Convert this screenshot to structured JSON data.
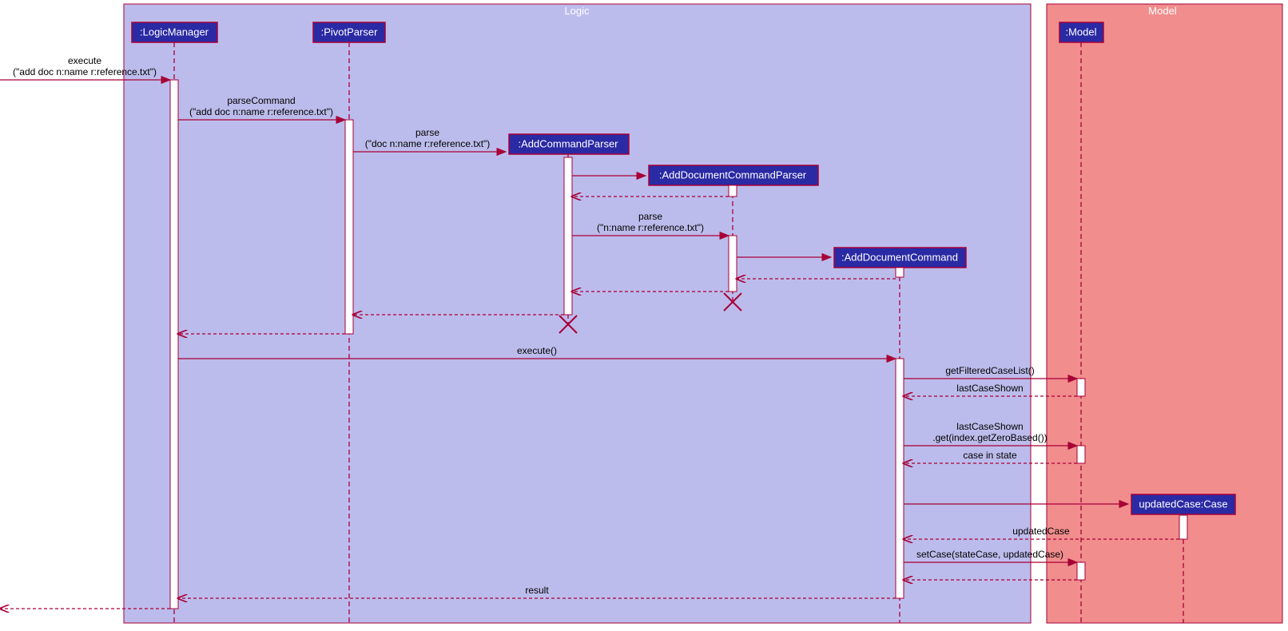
{
  "chart_data": {
    "type": "sequence_diagram",
    "boundaries": [
      {
        "name": "Logic",
        "participants": [
          "LogicManager",
          "PivotParser",
          "AddCommandParser",
          "AddDocumentCommandParser",
          "AddDocumentCommand"
        ]
      },
      {
        "name": "Model",
        "participants": [
          "Model",
          "updatedCase:Case"
        ]
      }
    ],
    "participants": [
      {
        "id": "logicManager",
        "label": ":LogicManager"
      },
      {
        "id": "pivotParser",
        "label": ":PivotParser"
      },
      {
        "id": "addCommandParser",
        "label": ":AddCommandParser"
      },
      {
        "id": "addDocumentCommandParser",
        "label": ":AddDocumentCommandParser"
      },
      {
        "id": "addDocumentCommand",
        "label": ":AddDocumentCommand"
      },
      {
        "id": "model",
        "label": ":Model"
      },
      {
        "id": "updatedCase",
        "label": "updatedCase:Case"
      }
    ],
    "messages": [
      {
        "from": "actor",
        "to": "logicManager",
        "label1": "execute",
        "label2": "(\"add doc n:name r:reference.txt\")",
        "type": "sync"
      },
      {
        "from": "logicManager",
        "to": "pivotParser",
        "label1": "parseCommand",
        "label2": "(\"add doc n:name r:reference.txt\")",
        "type": "sync"
      },
      {
        "from": "pivotParser",
        "to": "addCommandParser",
        "label1": "parse",
        "label2": "(\"doc n:name r:reference.txt\")",
        "type": "create"
      },
      {
        "from": "addCommandParser",
        "to": "addDocumentCommandParser",
        "label1": "",
        "label2": "",
        "type": "create"
      },
      {
        "from": "addDocumentCommandParser",
        "to": "addCommandParser",
        "label1": "",
        "label2": "",
        "type": "return"
      },
      {
        "from": "addCommandParser",
        "to": "addDocumentCommandParser",
        "label1": "parse",
        "label2": "(\"n:name r:reference.txt\")",
        "type": "sync"
      },
      {
        "from": "addDocumentCommandParser",
        "to": "addDocumentCommand",
        "label1": "",
        "label2": "",
        "type": "create"
      },
      {
        "from": "addDocumentCommand",
        "to": "addDocumentCommandParser",
        "label1": "",
        "label2": "",
        "type": "return"
      },
      {
        "from": "addDocumentCommandParser",
        "to": "addCommandParser",
        "label1": "",
        "label2": "",
        "type": "return"
      },
      {
        "from": "addCommandParser",
        "to": "pivotParser",
        "label1": "",
        "label2": "",
        "type": "return"
      },
      {
        "from": "pivotParser",
        "to": "logicManager",
        "label1": "",
        "label2": "",
        "type": "return"
      },
      {
        "from": "logicManager",
        "to": "addDocumentCommand",
        "label1": "execute()",
        "label2": "",
        "type": "sync"
      },
      {
        "from": "addDocumentCommand",
        "to": "model",
        "label1": "getFilteredCaseList()",
        "label2": "",
        "type": "sync"
      },
      {
        "from": "model",
        "to": "addDocumentCommand",
        "label1": "lastCaseShown",
        "label2": "",
        "type": "return"
      },
      {
        "from": "addDocumentCommand",
        "to": "model",
        "label1": "lastCaseShown",
        "label2": ".get(index.getZeroBased())",
        "type": "sync"
      },
      {
        "from": "model",
        "to": "addDocumentCommand",
        "label1": "case in state",
        "label2": "",
        "type": "return"
      },
      {
        "from": "addDocumentCommand",
        "to": "updatedCase",
        "label1": "",
        "label2": "",
        "type": "create"
      },
      {
        "from": "updatedCase",
        "to": "addDocumentCommand",
        "label1": "updatedCase",
        "label2": "",
        "type": "return"
      },
      {
        "from": "addDocumentCommand",
        "to": "model",
        "label1": "setCase(stateCase, updatedCase)",
        "label2": "",
        "type": "sync"
      },
      {
        "from": "model",
        "to": "addDocumentCommand",
        "label1": "",
        "label2": "",
        "type": "return"
      },
      {
        "from": "addDocumentCommand",
        "to": "logicManager",
        "label1": "result",
        "label2": "",
        "type": "return"
      },
      {
        "from": "logicManager",
        "to": "actor",
        "label1": "",
        "label2": "",
        "type": "return"
      }
    ],
    "destroys": [
      "addCommandParser",
      "addDocumentCommandParser"
    ]
  },
  "boundaries": {
    "logic": {
      "label": "Logic"
    },
    "model": {
      "label": "Model"
    }
  },
  "participants": {
    "logicManager": ":LogicManager",
    "pivotParser": ":PivotParser",
    "addCommandParser": ":AddCommandParser",
    "addDocumentCommandParser": ":AddDocumentCommandParser",
    "addDocumentCommand": ":AddDocumentCommand",
    "model": ":Model",
    "updatedCase": "updatedCase:Case"
  },
  "messages": {
    "m1a": "execute",
    "m1b": "(\"add doc n:name r:reference.txt\")",
    "m2a": "parseCommand",
    "m2b": "(\"add doc n:name r:reference.txt\")",
    "m3a": "parse",
    "m3b": "(\"doc n:name r:reference.txt\")",
    "m6a": "parse",
    "m6b": "(\"n:name r:reference.txt\")",
    "m12": "execute()",
    "m13": "getFilteredCaseList()",
    "m14": "lastCaseShown",
    "m15a": "lastCaseShown",
    "m15b": ".get(index.getZeroBased())",
    "m16": "case in state",
    "m18": "updatedCase",
    "m19": "setCase(stateCase, updatedCase)",
    "m21": "result"
  }
}
